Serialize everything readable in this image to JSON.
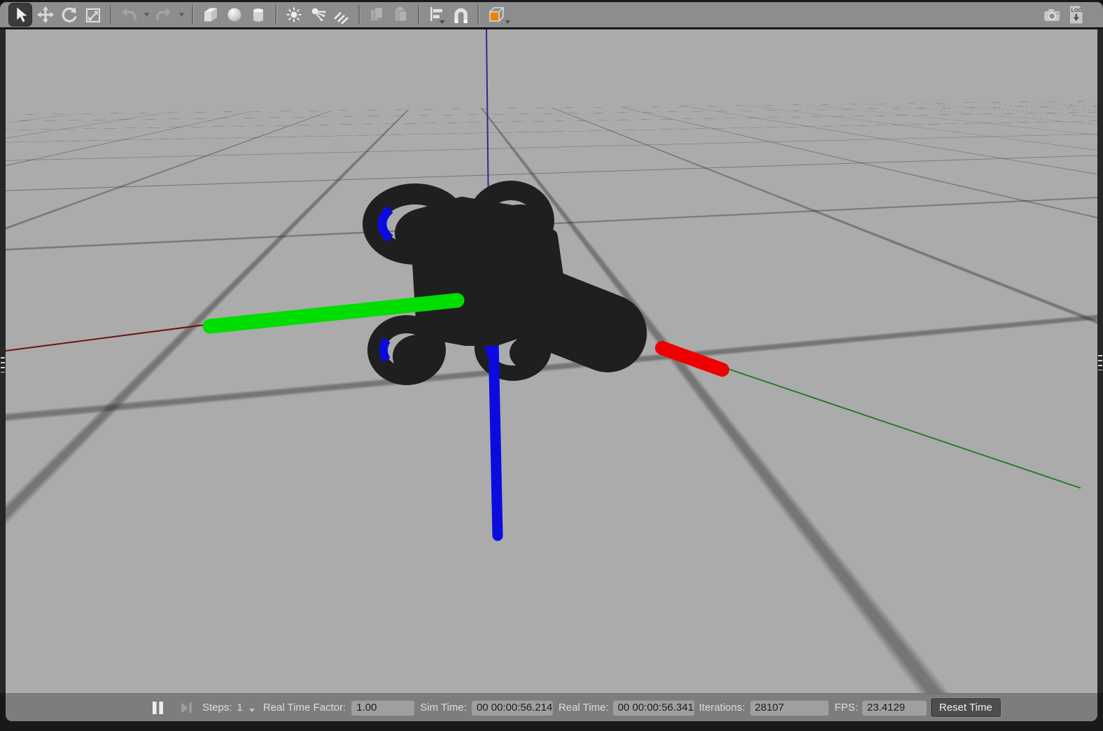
{
  "toolbar": {
    "tools": [
      {
        "name": "Select mode"
      },
      {
        "name": "Translate mode"
      },
      {
        "name": "Rotate mode"
      },
      {
        "name": "Scale mode"
      },
      {
        "name": "Undo"
      },
      {
        "name": "Undo history"
      },
      {
        "name": "Redo"
      },
      {
        "name": "Redo history"
      },
      {
        "name": "Box"
      },
      {
        "name": "Sphere"
      },
      {
        "name": "Cylinder"
      },
      {
        "name": "Point light"
      },
      {
        "name": "Spot light"
      },
      {
        "name": "Directional light"
      },
      {
        "name": "Copy"
      },
      {
        "name": "Paste"
      },
      {
        "name": "Align"
      },
      {
        "name": "Snap"
      },
      {
        "name": "Change view angle"
      },
      {
        "name": "Screenshot"
      },
      {
        "name": "Log recording"
      }
    ],
    "log_label": "LOG"
  },
  "statusbar": {
    "pause_button": "Pause",
    "step_button": "Step",
    "steps_label": "Steps:",
    "steps_value": "1",
    "real_time_factor_label": "Real Time Factor:",
    "real_time_factor_value": "1.00",
    "sim_time_label": "Sim Time:",
    "sim_time_value": "00 00:00:56.214",
    "real_time_label": "Real Time:",
    "real_time_value": "00 00:00:56.341",
    "iterations_label": "Iterations:",
    "iterations_value": "28107",
    "fps_label": "FPS:",
    "fps_value": "23.4129",
    "reset_button_label": "Reset Time"
  },
  "scene": {
    "background_color": "#ababab",
    "grid_line_color": "#8d8d8d",
    "model": "quadcopter",
    "model_color": "#1f1f1f",
    "model_accent_color": "#0a0ae0",
    "world_axis_colors": {
      "x": "#701212",
      "y": "#1d7a1d",
      "z": "#2b2b99"
    },
    "marker_axis_colors": {
      "x": "#ee0000",
      "y": "#00dd00",
      "z": "#0b0bdf"
    }
  }
}
